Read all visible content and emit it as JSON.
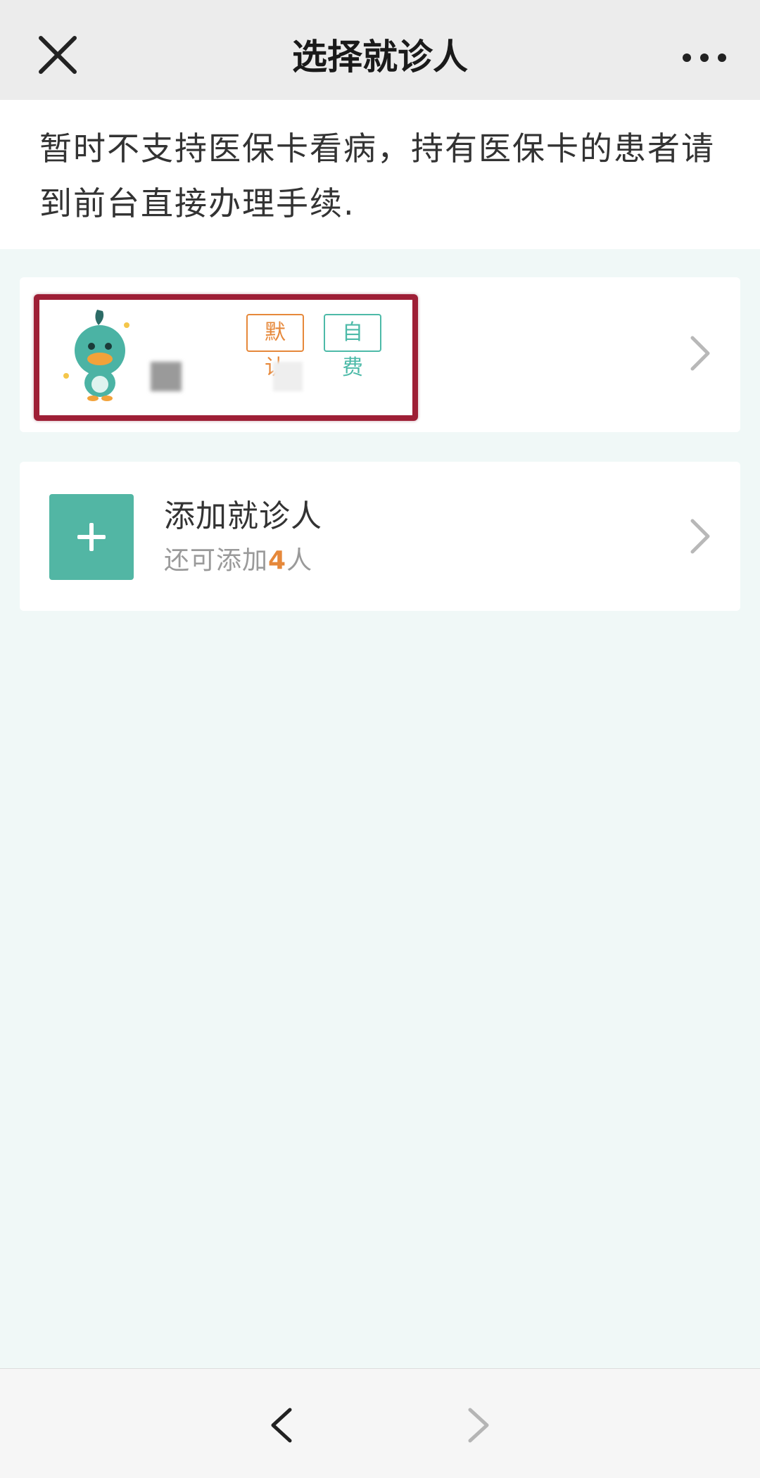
{
  "header": {
    "title": "选择就诊人"
  },
  "notice": {
    "text": "暂时不支持医保卡看病，持有医保卡的患者请到前台直接办理手续."
  },
  "patient": {
    "tags": {
      "default_label": "默认",
      "self_pay_label": "自费"
    }
  },
  "add_patient": {
    "title": "添加就诊人",
    "subtitle_prefix": "还可添加",
    "remaining_count": "4",
    "subtitle_suffix": "人"
  },
  "colors": {
    "accent_teal": "#52b6a4",
    "accent_orange": "#e6883a",
    "highlight_red": "#9e1f36"
  },
  "icons": {
    "close": "close-icon",
    "more": "more-icon",
    "avatar": "duck-avatar-icon",
    "plus": "plus-icon",
    "chevron": "chevron-right-icon",
    "back": "chevron-left-icon",
    "forward": "chevron-right-icon"
  }
}
